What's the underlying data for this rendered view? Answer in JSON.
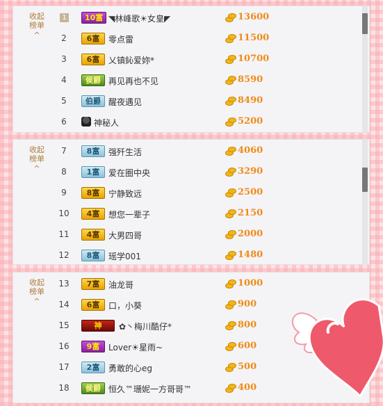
{
  "collapse_label": "收起\n榜单",
  "collapse_line1": "收起",
  "collapse_line2": "榜单",
  "collapse_caret": "^",
  "panels": [
    {
      "rows": [
        {
          "rank": "1",
          "badge": "10富",
          "badge_color": "purple",
          "name": "◥林峰歌☀女皇◤",
          "amount": "13600"
        },
        {
          "rank": "2",
          "badge": "6富",
          "badge_color": "yellow",
          "name": "零点雷",
          "amount": "11500"
        },
        {
          "rank": "3",
          "badge": "6富",
          "badge_color": "yellow",
          "name": "乂镇鈊爱妳*",
          "amount": "10700"
        },
        {
          "rank": "4",
          "badge": "侯爵",
          "badge_color": "green",
          "name": "再见再也不见",
          "amount": "8590"
        },
        {
          "rank": "5",
          "badge": "伯爵",
          "badge_color": "blue",
          "name": "醒夜遇见",
          "amount": "8490"
        },
        {
          "rank": "6",
          "badge": "",
          "badge_color": "mystery",
          "name": "神秘人",
          "amount": "5200"
        }
      ]
    },
    {
      "rows": [
        {
          "rank": "7",
          "badge": "8富",
          "badge_color": "blue",
          "name": "强歼生活",
          "amount": "4060"
        },
        {
          "rank": "8",
          "badge": "1富",
          "badge_color": "blue",
          "name": "爱在圈中央",
          "amount": "3290"
        },
        {
          "rank": "9",
          "badge": "8富",
          "badge_color": "yellow",
          "name": "宁静致远",
          "amount": "2500"
        },
        {
          "rank": "10",
          "badge": "4富",
          "badge_color": "yellow",
          "name": "想您一辈子",
          "amount": "2150"
        },
        {
          "rank": "11",
          "badge": "4富",
          "badge_color": "yellow",
          "name": "大男四哥",
          "amount": "2000"
        },
        {
          "rank": "12",
          "badge": "8富",
          "badge_color": "blue",
          "name": "瑶学001",
          "amount": "1480"
        }
      ]
    },
    {
      "rows": [
        {
          "rank": "13",
          "badge": "7富",
          "badge_color": "yellow",
          "name": "油龙哥",
          "amount": "1000"
        },
        {
          "rank": "14",
          "badge": "6富",
          "badge_color": "yellow",
          "name": "口，小葵",
          "amount": "900"
        },
        {
          "rank": "15",
          "badge": "神",
          "badge_color": "red",
          "name": "✿丶梅川酷仔*",
          "amount": "800"
        },
        {
          "rank": "16",
          "badge": "9富",
          "badge_color": "purple",
          "name": "Lover☀星雨~",
          "amount": "600"
        },
        {
          "rank": "17",
          "badge": "2富",
          "badge_color": "blue",
          "name": "勇敢的心eg",
          "amount": "500"
        },
        {
          "rank": "18",
          "badge": "侯爵",
          "badge_color": "green",
          "name": "恒久™珊妮一方哥哥™",
          "amount": "400"
        }
      ]
    }
  ],
  "colors": {
    "amount": "#f08a17",
    "collapse": "#b07c3c",
    "background": "#fde3e5"
  }
}
